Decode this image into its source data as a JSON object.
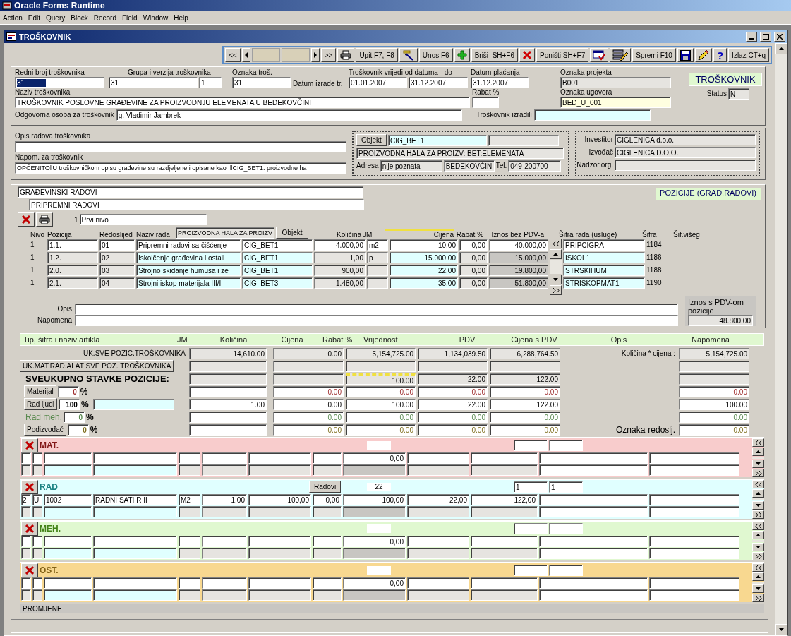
{
  "app": {
    "title": "Oracle Forms Runtime"
  },
  "menu": [
    "Action",
    "Edit",
    "Query",
    "Block",
    "Record",
    "Field",
    "Window",
    "Help"
  ],
  "window": {
    "title": "TROŠKOVNIK"
  },
  "toolbar": [
    {
      "kind": "text",
      "label": "<<"
    },
    {
      "kind": "prev"
    },
    {
      "kind": "counter"
    },
    {
      "kind": "next"
    },
    {
      "kind": "text",
      "label": ">>"
    },
    {
      "kind": "print"
    },
    {
      "kind": "text",
      "label": "Upit F7, F8"
    },
    {
      "kind": "query"
    },
    {
      "kind": "text",
      "label": "Unos F6"
    },
    {
      "kind": "add"
    },
    {
      "kind": "text",
      "label": "Briši  SH+F6"
    },
    {
      "kind": "delete"
    },
    {
      "kind": "text",
      "label": "Poništi SH+F7"
    },
    {
      "kind": "undo"
    },
    {
      "kind": "edit"
    },
    {
      "kind": "text",
      "label": "Spremi F10"
    },
    {
      "kind": "save"
    },
    {
      "kind": "pencil"
    },
    {
      "kind": "help",
      "label": "?"
    },
    {
      "kind": "text",
      "label": "Izlaz CT+q"
    }
  ],
  "header": {
    "redni_broj": {
      "label": "Redni broj troškovnika",
      "value": "31",
      "focused": true
    },
    "grupa": {
      "label": "Grupa i verzija troškovnika",
      "value": "31",
      "version": "1"
    },
    "oznaka": {
      "label": "Oznaka troš.",
      "value": "31"
    },
    "datum_izrade": {
      "label": "Datum izrade tr."
    },
    "vrijedi": {
      "label": "Troškovnik vrijedi od datuma - do",
      "from": "01.01.2007",
      "to": "31.12.2007"
    },
    "datum_placanja": {
      "label": "Datum plaćanja",
      "value": "31.12.2007"
    },
    "oznaka_projekta": {
      "label": "Oznaka projekta",
      "value": "B001"
    },
    "form_badge": "TROŠKOVNIK",
    "status": {
      "label": "Status",
      "value": "N"
    },
    "naziv": {
      "label": "Naziv troškovnika",
      "value": "TROŠKOVNIK POSLOVNE GRAĐEVINE ZA PROIZVODNJU ELEMENATA U BEDEKOVČINI"
    },
    "rabat": {
      "label": "Rabat %"
    },
    "oznaka_ugovora": {
      "label": "Oznaka ugovora",
      "value": "BED_U_001"
    },
    "odgovorna": {
      "label": "Odgovorna osoba za troškovnik",
      "value": "g. Vladimir Jambrek"
    },
    "izradili": {
      "label": "Troškovnik izradili"
    }
  },
  "opis": {
    "label": "Opis radova troškovnika"
  },
  "napomena": {
    "label": "Napom. za troškovnik",
    "value": "OPĆENITO‖U troškovničkom opisu građevine su razdjeljene i opisane kao :‖CIG_BET1: proizvodne ha"
  },
  "objekt": {
    "button": "Objekt",
    "code": "CIG_BET1",
    "name": "PROIZVODNA HALA ZA PROIZV: BET:ELEMENATA",
    "adresa_label": "Adresa",
    "adresa": "nije poznata",
    "mjesto": "BEDEKOVČIN",
    "tel_label": "Tel.",
    "tel": "049-200700"
  },
  "sudionici": [
    {
      "label": "Investitor",
      "value": "CIGLENICA d.o.o."
    },
    {
      "label": "Izvođač",
      "value": "CIGLENICA D.O.O."
    },
    {
      "label": "Nadzor.org."
    }
  ],
  "pozicije": {
    "group": "GRAĐEVINSKI RADOVI",
    "subgroup": "PRIPREMNI RADOVI",
    "badge": "POZICIJE (GRAĐ.RADOVI)",
    "level_no": "1",
    "level_name": "Prvi nivo",
    "columns": [
      "Nivo",
      "Pozicija",
      "Redoslijed",
      "Naziv rada",
      "Količina",
      "JM",
      "Cijena",
      "Rabat %",
      "Iznos bez PDV-a",
      "Šifra rada (usluge)",
      "Šifra",
      "Šif.višeg"
    ],
    "object_filter": "PROIZVODNA HALA ZA PROIZV",
    "object_button": "Objekt",
    "rows": [
      {
        "selected": true,
        "nivo": "1",
        "pozicija": "1.1.",
        "redoslijed": "01",
        "naziv": "Pripremni radovi sa čišćenje",
        "objekt": "CIG_BET1",
        "kolicina": "4.000,00",
        "jm": "m2",
        "cijena": "10,00",
        "rabat": "0,00",
        "iznos": "40.000,00",
        "sifra_rada": "PRIPCIGRA",
        "sifra": "1184"
      },
      {
        "selected": false,
        "nivo": "1",
        "pozicija": "1.2.",
        "redoslijed": "02",
        "naziv": "Iskolčenje građevina i ostali",
        "objekt": "CIG_BET1",
        "kolicina": "1,00",
        "jm": "p",
        "cijena": "15.000,00",
        "rabat": "0,00",
        "iznos": "15.000,00",
        "sifra_rada": "ISKOL1",
        "sifra": "1186"
      },
      {
        "selected": false,
        "nivo": "1",
        "pozicija": "2.0.",
        "redoslijed": "03",
        "naziv": "Strojno skidanje humusa i ze",
        "objekt": "CIG_BET1",
        "kolicina": "900,00",
        "cijena": "22,00",
        "rabat": "0,00",
        "iznos": "19.800,00",
        "sifra_rada": "STRSKIHUM",
        "sifra": "1188"
      },
      {
        "selected": false,
        "nivo": "1",
        "pozicija": "2.1.",
        "redoslijed": "04",
        "naziv": "Strojni iskop materijala III/I",
        "objekt": "CIG_BET3",
        "kolicina": "1.480,00",
        "cijena": "35,00",
        "rabat": "0,00",
        "iznos": "51.800,00",
        "sifra_rada": "STRISKOPMAT1",
        "sifra": "1190"
      }
    ],
    "opis_label": "Opis",
    "napomena_label": "Napomena",
    "iznos_pdv_label": "Iznos s PDV-om pozicije",
    "iznos_pdv": "48.800,00"
  },
  "stavke": {
    "columns": [
      "Tip, šifra i naziv artikla",
      "JM",
      "Količina",
      "Cijena",
      "Rabat %",
      "Vrijednost",
      "PDV",
      "Cijena s PDV",
      "Opis",
      "Napomena"
    ],
    "summary": [
      {
        "kind": "total",
        "label": "UK.SVE POZIC.TROŠKOVNIKA",
        "kolicina": "14,610.00",
        "cijena": "0.00",
        "vrijednost": "5,154,725.00",
        "pdv": "1,134,039.50",
        "cijena_pdv": "6,288,764.50",
        "note_label": "Količina * cijena :",
        "napomena": "5,154,725.00"
      },
      {
        "kind": "button",
        "label": "UK.MAT.RAD.ALAT SVE POZ. TROŠKOVNIKA"
      },
      {
        "kind": "heading",
        "label": "SVEUKUPNO STAVKE POZICIJE:",
        "vrijednost": "100.00",
        "pdv": "22.00",
        "cijena_pdv": "122.00"
      },
      {
        "kind": "share",
        "label": "Materijal",
        "button": true,
        "code_field": false,
        "percent": "0",
        "percent_sign": "%",
        "color": "#a03030",
        "cijena": "0.00",
        "vrijednost": "0.00",
        "pdv": "0.00",
        "cijena_pdv": "0.00",
        "napomena": "0.00"
      },
      {
        "kind": "share",
        "label": "Rad ljudi",
        "button": true,
        "code_field": true,
        "percent": "100",
        "percent_sign": "%",
        "color": "#000000",
        "kolicina": "1.00",
        "cijena": "0.00",
        "vrijednost": "100.00",
        "pdv": "22.00",
        "cijena_pdv": "122.00",
        "napomena": "100.00"
      },
      {
        "kind": "share",
        "label": "Rad meh.",
        "button": false,
        "code_field": false,
        "percent": "0",
        "percent_sign": "%",
        "color": "#5a8a50",
        "cijena": "0.00",
        "vrijednost": "0.00",
        "pdv": "0.00",
        "cijena_pdv": "0.00",
        "napomena": "0.00"
      },
      {
        "kind": "share",
        "label": "Podizvođač",
        "button": true,
        "code_field": false,
        "percent": "0",
        "percent_sign": "%",
        "color": "#807020",
        "cijena": "0.00",
        "vrijednost": "0.00",
        "pdv": "0.00",
        "cijena_pdv": "0.00",
        "napomena": "0.00"
      }
    ],
    "order_labels": [
      "Oznaka",
      "redoslj."
    ],
    "sections": [
      {
        "title": "MAT.",
        "color": "#f8cccc",
        "rows": [
          {
            "vrijednost": "0,00"
          }
        ]
      },
      {
        "title": "RAD",
        "color": "#e0ffff",
        "button": "Radovi",
        "count": "22",
        "oznaka": "1",
        "redoslijed": "1",
        "rows": [
          {
            "tip": "2",
            "vrsta": "U",
            "sifra": "1002",
            "naziv": "RADNI SATI R II",
            "jm": "M2",
            "kolicina": "1,00",
            "cijena": "100,00",
            "rabat": "0,00",
            "vrijednost": "100,00",
            "pdv": "22,00",
            "cijena_pdv": "122,00"
          }
        ]
      },
      {
        "title": "MEH.",
        "color": "#e0f8d0",
        "rows": [
          {
            "vrijednost": "0,00"
          }
        ]
      },
      {
        "title": "OST.",
        "color": "#f8d890",
        "rows": [
          {
            "vrijednost": "0,00"
          }
        ]
      }
    ]
  },
  "promjene": "PROMJENE"
}
